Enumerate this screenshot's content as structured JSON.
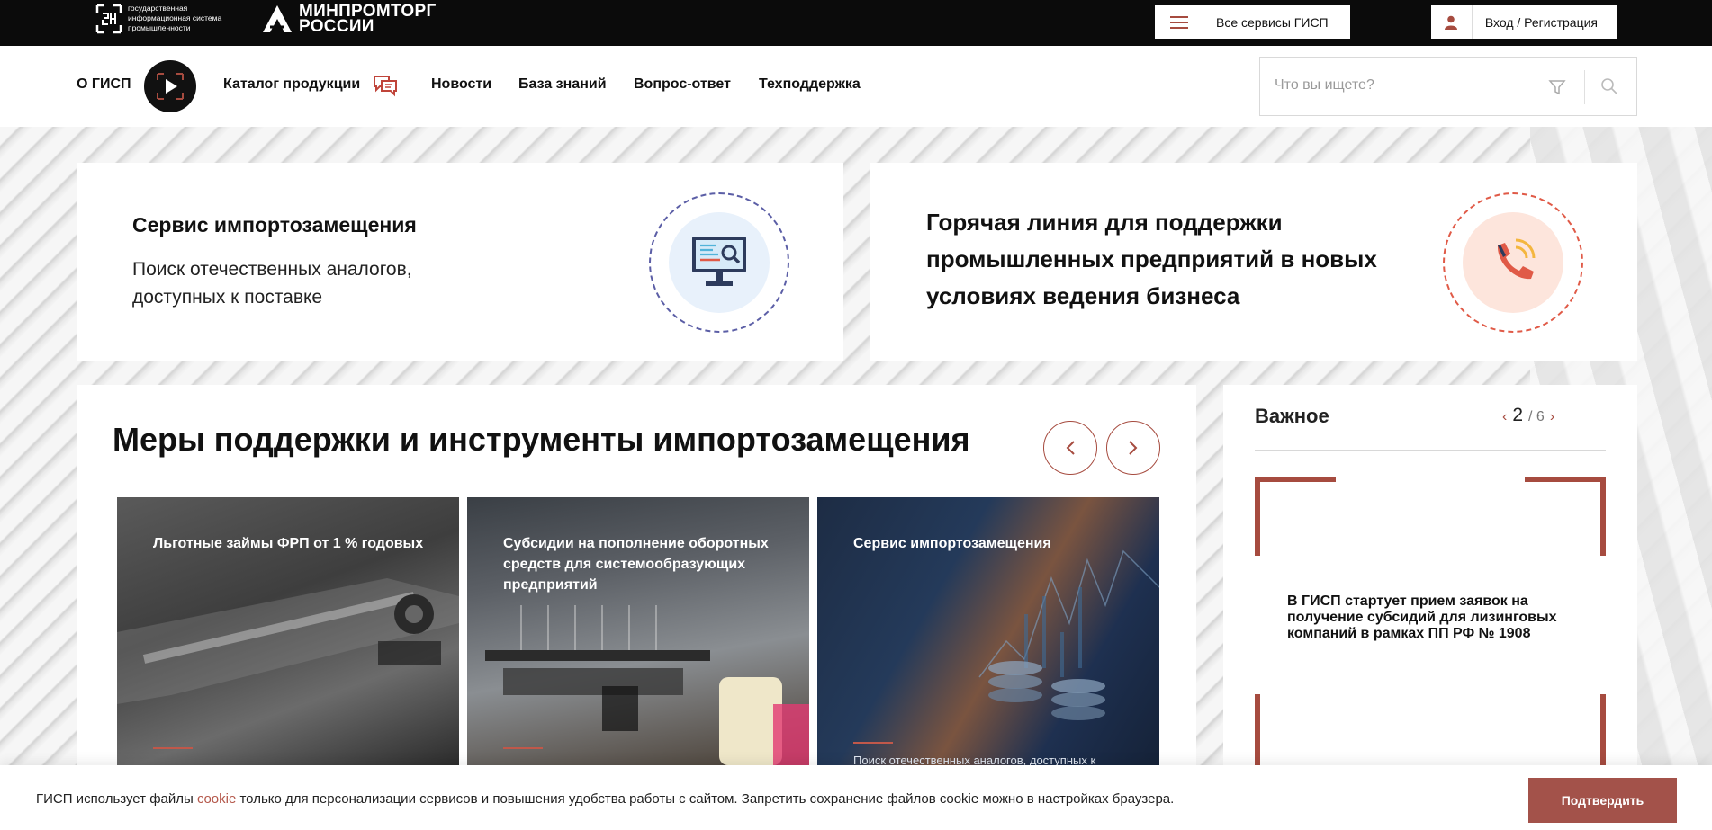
{
  "topbar": {
    "gisp_logo_text": "государственная информационная система промышленности",
    "ministry_logo_text_line1": "МИНПРОМТОРГ",
    "ministry_logo_text_line2": "РОССИИ",
    "services_button": {
      "label": "Все сервисы ГИСП",
      "icon": "hamburger-icon"
    },
    "login_button": {
      "label": "Вход / Регистрация",
      "icon": "user-icon"
    }
  },
  "nav": {
    "about": "О ГИСП",
    "catalog": "Каталог продукции",
    "news": "Новости",
    "knowledge": "База знаний",
    "qa": "Вопрос-ответ",
    "support": "Техподдержка"
  },
  "search": {
    "placeholder": "Что вы ищете?",
    "value": ""
  },
  "cards": {
    "import_service": {
      "title": "Сервис импортозамещения",
      "description": "Поиск отечественных аналогов, доступных к поставке",
      "icon": "monitor-search-icon"
    },
    "hotline": {
      "title": "Горячая линия для поддержки промышленных предприятий в новых условиях ведения бизнеса",
      "icon": "phone-call-icon"
    }
  },
  "measures": {
    "title": "Меры поддержки и инструменты импортозамещения",
    "items": [
      {
        "title": "Льготные займы ФРП от 1 % годовых",
        "description": ""
      },
      {
        "title": "Субсидии на пополнение оборотных средств для системообразующих предприятий",
        "description": ""
      },
      {
        "title": "Сервис импортозамещения",
        "description": "Поиск отечественных аналогов, доступных к"
      }
    ]
  },
  "important": {
    "title": "Важное",
    "current": "2",
    "total": "/ 6",
    "text": "В ГИСП стартует прием заявок на получение субсидий для лизинговых компаний в рамках ПП РФ № 1908"
  },
  "cookie": {
    "text_before": "ГИСП использует файлы ",
    "link": "cookie",
    "text_after": " только для персонализации сервисов и повышения удобства работы с сайтом. Запретить сохранение файлов cookie можно в настройках браузера.",
    "button": "Подтвердить"
  },
  "colors": {
    "accent": "#a64b3f",
    "topbar_bg": "#0b0b0b",
    "cookie_button": "#a3524a"
  }
}
